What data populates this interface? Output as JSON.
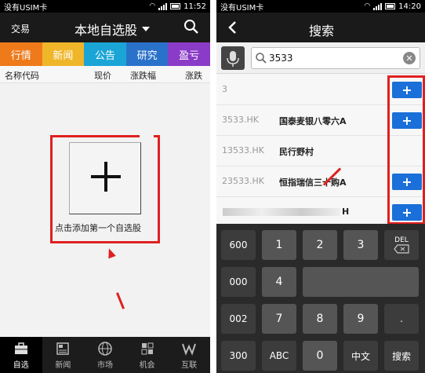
{
  "left": {
    "status": {
      "carrier": "没有USIM卡",
      "time": "11:52"
    },
    "header": {
      "trade": "交易",
      "title": "本地自选股"
    },
    "tabs": [
      {
        "label": "行情",
        "color": "#ee7a1a"
      },
      {
        "label": "新闻",
        "color": "#f0b62a"
      },
      {
        "label": "公告",
        "color": "#1aa5d6"
      },
      {
        "label": "研究",
        "color": "#2a72c9"
      },
      {
        "label": "盈亏",
        "color": "#8a3bc7"
      }
    ],
    "columns": [
      "名称代码",
      "现价",
      "涨跌幅",
      "涨跌"
    ],
    "add_first_label": "点击添加第一个自选股",
    "bottom_nav": [
      {
        "label": "自选",
        "icon": "briefcase-icon",
        "active": true
      },
      {
        "label": "新闻",
        "icon": "newspaper-icon",
        "active": false
      },
      {
        "label": "市场",
        "icon": "globe-icon",
        "active": false
      },
      {
        "label": "机会",
        "icon": "grid-icon",
        "active": false
      },
      {
        "label": "互联",
        "icon": "w-icon",
        "active": false
      }
    ]
  },
  "right": {
    "status": {
      "carrier": "没有USIM卡",
      "time": "14:20"
    },
    "header": {
      "title": "搜索"
    },
    "search": {
      "value": "3533"
    },
    "results": [
      {
        "code": "3",
        "name": ""
      },
      {
        "code": "3533.HK",
        "name": "国泰麦银八零六A"
      },
      {
        "code": "13533.HK",
        "name": "民行野村"
      },
      {
        "code": "23533.HK",
        "name": "恒指瑞信三十购A"
      },
      {
        "code": "",
        "name": "H"
      }
    ],
    "keypad": {
      "row1": [
        "600",
        "1",
        "2",
        "3",
        "DEL"
      ],
      "row2": [
        "000",
        "4"
      ],
      "row3": [
        "002",
        "7",
        "8",
        "9",
        "."
      ],
      "row4": [
        "300",
        "ABC",
        "0",
        "中文",
        "搜索"
      ]
    }
  }
}
